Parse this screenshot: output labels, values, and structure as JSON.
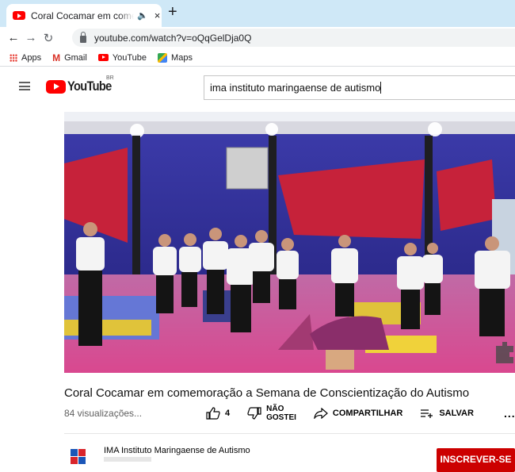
{
  "browser": {
    "tab_title": "Coral Cocamar em comemoração",
    "tab_audio_icon": "speaker-icon",
    "tab_close": "×",
    "new_tab": "+",
    "url": "youtube.com/watch?v=oQqGelDja0Q",
    "bookmarks": [
      {
        "label": "Apps",
        "icon": "apps-grid-icon"
      },
      {
        "label": "Gmail",
        "icon": "gmail-icon"
      },
      {
        "label": "YouTube",
        "icon": "youtube-icon"
      },
      {
        "label": "Maps",
        "icon": "maps-icon"
      }
    ]
  },
  "youtube": {
    "logo_text": "YouTube",
    "country_code": "BR",
    "search_value": "ima instituto maringaense de autismo"
  },
  "video": {
    "title": "Coral Cocamar em comemoração a Semana de Conscientização do Autismo",
    "views": "84 visualizações...",
    "like_count": "4",
    "dislike_line1": "NÃO",
    "dislike_line2": "GOSTEI",
    "share_label": "COMPARTILHAR",
    "save_label": "SALVAR",
    "more_label": "..."
  },
  "channel": {
    "name": "IMA Instituto Maringaense de Autismo",
    "subscribe_label": "INSCREVER-SE"
  },
  "colors": {
    "youtube_red": "#ff0000",
    "subscribe_red": "#cc0000",
    "tabstrip": "#cfe8f7"
  }
}
